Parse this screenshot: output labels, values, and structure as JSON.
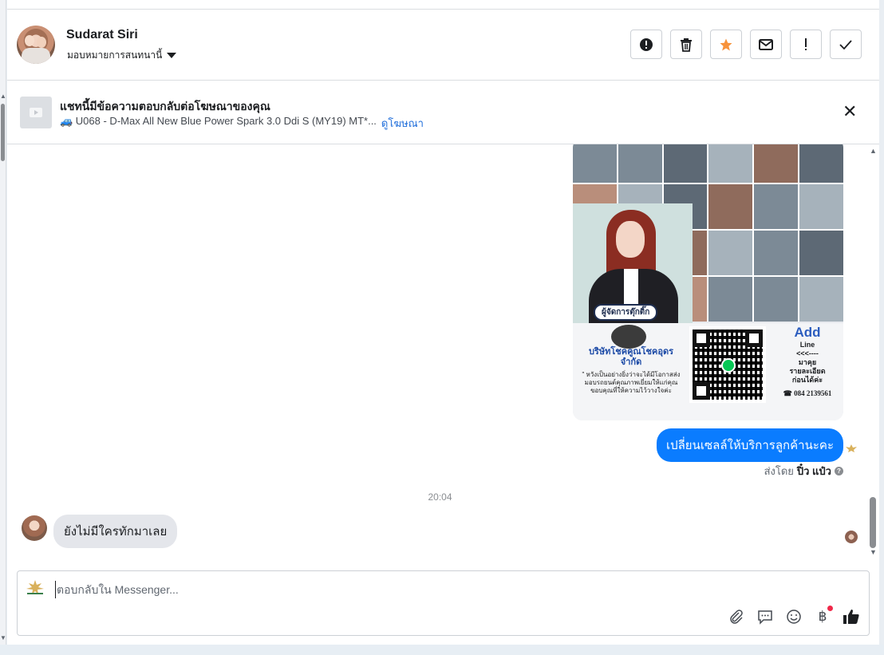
{
  "header": {
    "contact_name": "Sudarat Siri",
    "assign_label": "มอบหมายการสนทนานี้",
    "actions": [
      {
        "name": "report-spam",
        "icon": "alert-circle-icon"
      },
      {
        "name": "delete",
        "icon": "trash-icon"
      },
      {
        "name": "star",
        "icon": "star-icon",
        "color": "#f7923b"
      },
      {
        "name": "mark-unread",
        "icon": "envelope-icon"
      },
      {
        "name": "flag-follow-up",
        "icon": "exclamation-icon"
      },
      {
        "name": "mark-done",
        "icon": "check-icon"
      }
    ]
  },
  "ad_banner": {
    "title": "แชทนี้มีข้อความตอบกลับต่อโฆษณาของคุณ",
    "ad_name": "🚙 U068 - D-Max All New Blue Power Spark 3.0 Ddi S (MY19) MT*...",
    "view_ad_label": "ดูโฆษณา",
    "close_icon": "close-icon"
  },
  "poster": {
    "badge": "ผู้จัดการตุ๊กติ๊ก",
    "company": "บริษัทโชคคูณโชคอุดร จำกัด",
    "slogan": "\" หวังเป็นอย่างยิ่งว่าจะได้มีโอกาสส่งมอบรถยนต์คุณภาพเยี่ยมให้แก่คุณขอบคุณที่ให้ความไว้วางใจค่ะ",
    "add": "Add",
    "line": "Line",
    "arrow": "<<<----",
    "talk1": "มาคุย",
    "talk2": "รายละเอียด",
    "talk3": "ก่อนได้ค่ะ",
    "phone": "084 2139561"
  },
  "messages": {
    "outgoing_text": "เปลี่ยนเซลล์ให้บริการลูกค้านะคะ",
    "sent_by_prefix": "ส่งโดย",
    "sent_by_name": "ปิ๋ว แป๋ว",
    "timestamp": "20:04",
    "incoming_text": "ยังไม่มีใครทักมาเลย"
  },
  "composer": {
    "placeholder": "ตอบกลับใน Messenger...",
    "tools": [
      "paperclip-icon",
      "saved-reply-icon",
      "emoji-icon",
      "baht-payment-icon",
      "thumbs-up-icon"
    ]
  },
  "colors": {
    "accent": "#0a7cff",
    "link": "#216fdb",
    "star": "#f7923b",
    "notification_dot": "#f02849"
  }
}
